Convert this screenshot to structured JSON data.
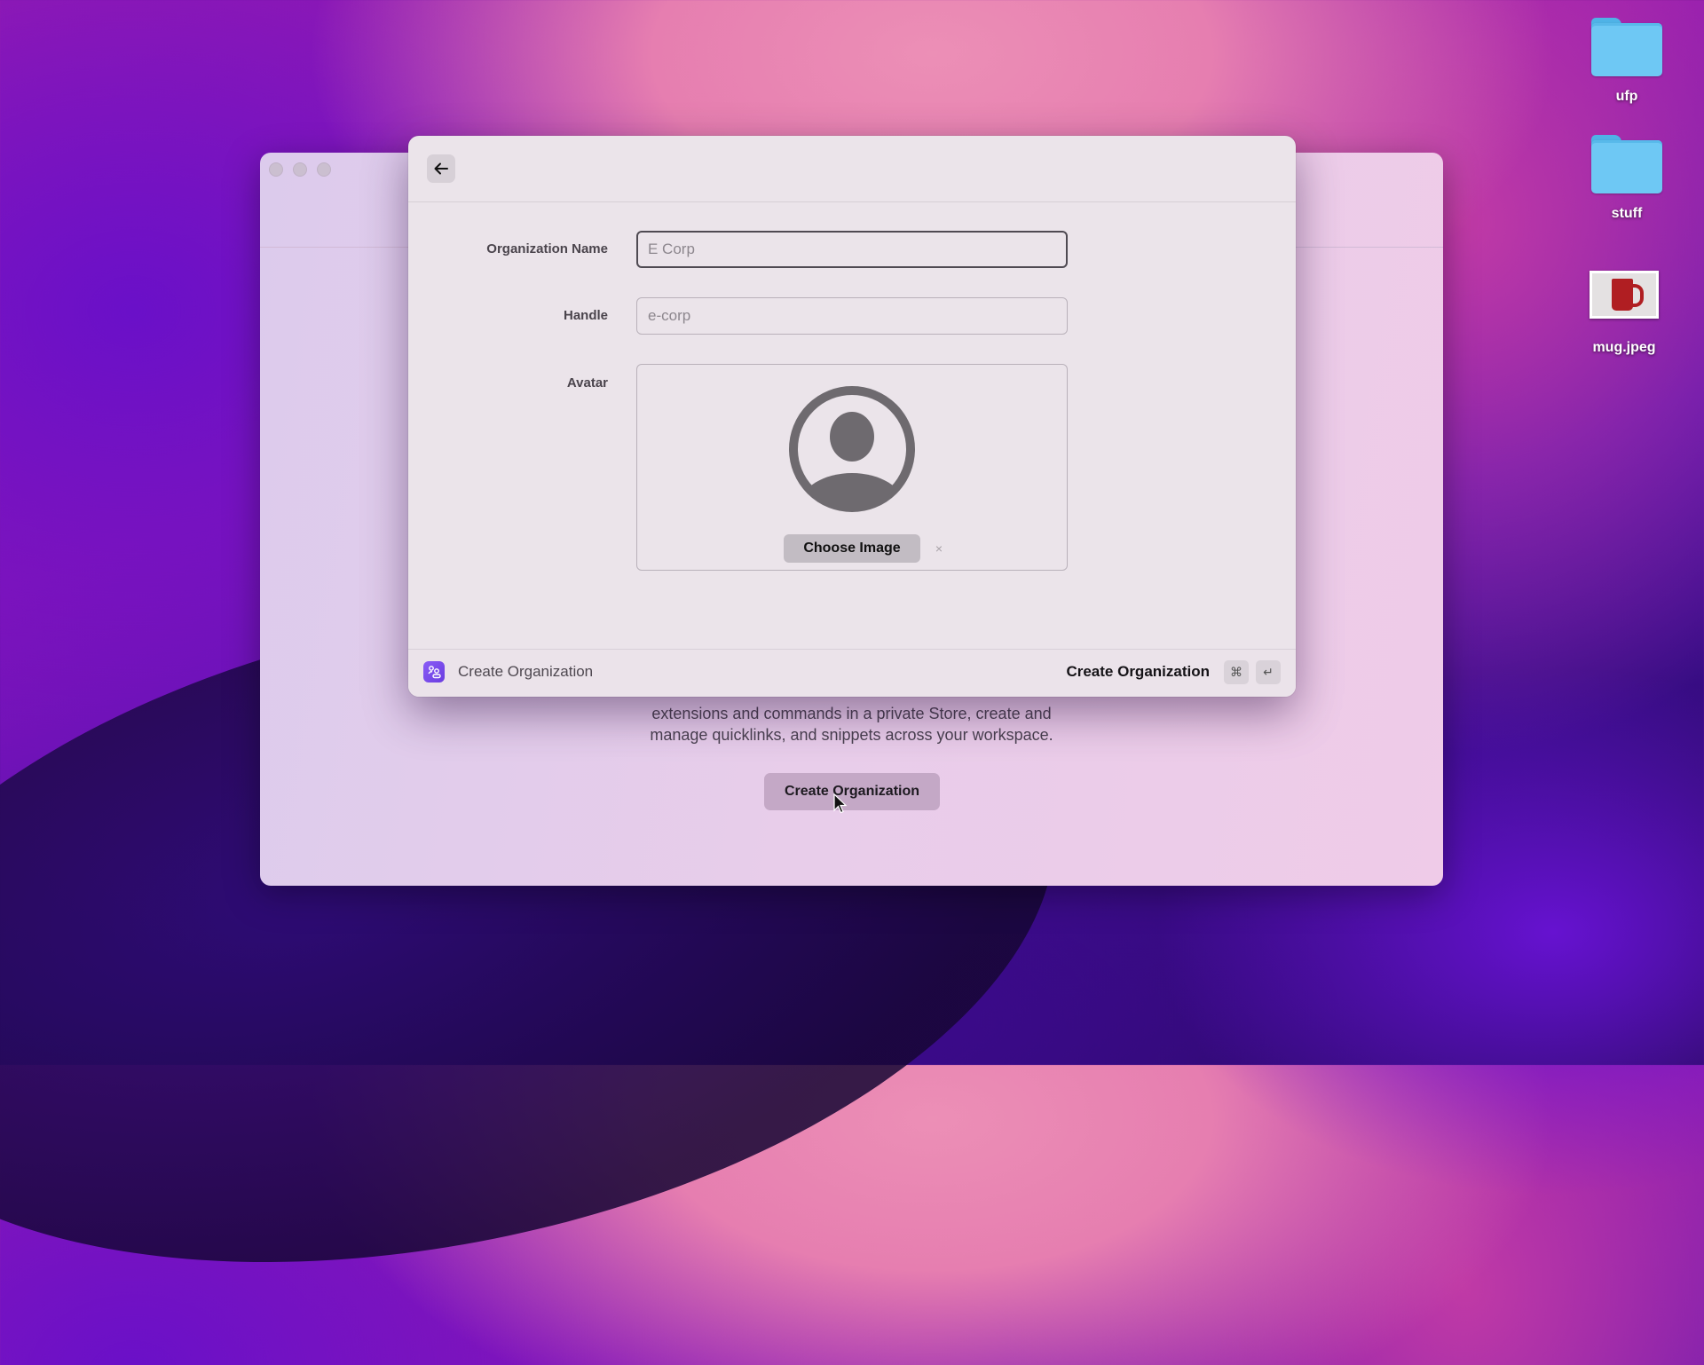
{
  "desktop": {
    "icons": [
      {
        "label": "ufp",
        "type": "folder"
      },
      {
        "label": "stuff",
        "type": "folder"
      },
      {
        "label": "mug.jpeg",
        "type": "image"
      }
    ]
  },
  "background_window": {
    "description_line_1": "extensions and commands in a private Store, create and",
    "description_line_2": "manage quicklinks, and snippets across your workspace.",
    "button_label": "Create Organization"
  },
  "dialog": {
    "back_icon": "arrow-left-icon",
    "form": {
      "org_name_label": "Organization Name",
      "org_name_placeholder": "E Corp",
      "org_name_value": "",
      "handle_label": "Handle",
      "handle_placeholder": "e-corp",
      "handle_value": "",
      "avatar_label": "Avatar",
      "avatar_icon": "person-circle-icon",
      "choose_image_label": "Choose Image",
      "clear_label": "×"
    },
    "footer": {
      "icon": "organization-icon",
      "title": "Create Organization",
      "action_label": "Create Organization",
      "shortcut_keys": [
        "⌘",
        "↵"
      ]
    }
  },
  "colors": {
    "accent": "#7a4cf0",
    "dialog_bg": "#ebe4ea",
    "avatar_gray": "#6e6a6f"
  }
}
